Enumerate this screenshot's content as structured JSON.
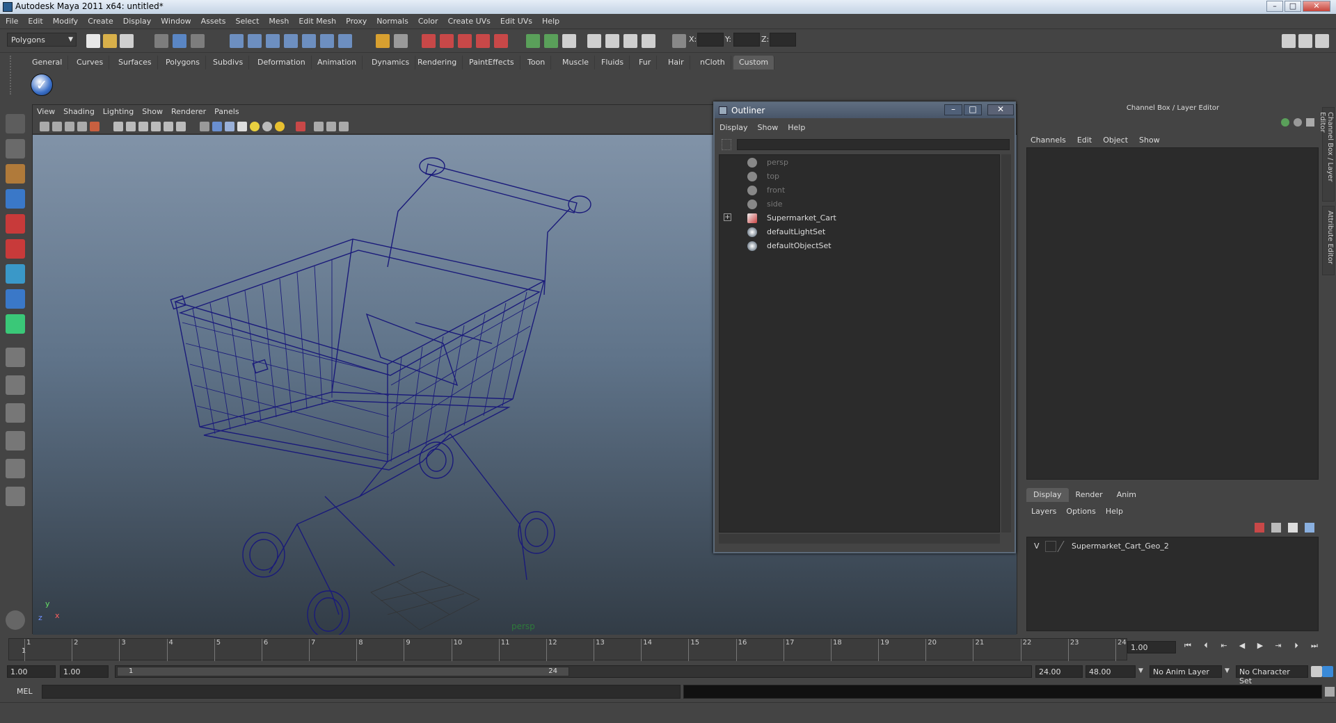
{
  "window": {
    "title": "Autodesk Maya 2011 x64: untitled*"
  },
  "menubar": [
    "File",
    "Edit",
    "Modify",
    "Create",
    "Display",
    "Window",
    "Assets",
    "Select",
    "Mesh",
    "Edit Mesh",
    "Proxy",
    "Normals",
    "Color",
    "Create UVs",
    "Edit UVs",
    "Help"
  ],
  "status": {
    "mode": "Polygons",
    "x_label": "X:",
    "y_label": "Y:",
    "z_label": "Z:"
  },
  "shelf_tabs": [
    "General",
    "Curves",
    "Surfaces",
    "Polygons",
    "Subdivs",
    "Deformation",
    "Animation",
    "Dynamics",
    "Rendering",
    "PaintEffects",
    "Toon",
    "Muscle",
    "Fluids",
    "Fur",
    "Hair",
    "nCloth",
    "Custom"
  ],
  "shelf_active": "Custom",
  "viewport": {
    "menus": [
      "View",
      "Shading",
      "Lighting",
      "Show",
      "Renderer",
      "Panels"
    ],
    "camera_label": "persp",
    "axis": {
      "x": "x",
      "y": "y",
      "z": "z"
    }
  },
  "outliner": {
    "title": "Outliner",
    "menus": [
      "Display",
      "Show",
      "Help"
    ],
    "items": [
      {
        "label": "persp",
        "icon": "camera-icon",
        "dim": true
      },
      {
        "label": "top",
        "icon": "camera-icon",
        "dim": true
      },
      {
        "label": "front",
        "icon": "camera-icon",
        "dim": true
      },
      {
        "label": "side",
        "icon": "camera-icon",
        "dim": true
      },
      {
        "label": "Supermarket_Cart",
        "icon": "mesh-icon",
        "dim": false,
        "expandable": true
      },
      {
        "label": "defaultLightSet",
        "icon": "set-icon",
        "dim": false
      },
      {
        "label": "defaultObjectSet",
        "icon": "set-icon",
        "dim": false
      }
    ],
    "expander_symbol": "+"
  },
  "channelbox": {
    "header": "Channel Box / Layer Editor",
    "menus": [
      "Channels",
      "Edit",
      "Object",
      "Show"
    ],
    "layer_tabs": [
      "Display",
      "Render",
      "Anim"
    ],
    "layer_tab_active": "Display",
    "layer_menus": [
      "Layers",
      "Options",
      "Help"
    ],
    "layers": [
      {
        "visible": "V",
        "name": "Supermarket_Cart_Geo_2"
      }
    ],
    "side_tabs": [
      "Channel Box / Layer Editor",
      "Attribute Editor"
    ]
  },
  "timeline": {
    "ticks": [
      1,
      2,
      3,
      4,
      5,
      6,
      7,
      8,
      9,
      10,
      11,
      12,
      13,
      14,
      15,
      16,
      17,
      18,
      19,
      20,
      21,
      22,
      23,
      24
    ],
    "current_frame": "1",
    "current_frame_field": "1.00"
  },
  "range": {
    "start": "1.00",
    "playback_start": "1.00",
    "slider_start": "1",
    "slider_end": "24",
    "playback_end": "24.00",
    "end": "48.00",
    "anim_layer": "No Anim Layer",
    "character_set": "No Character Set"
  },
  "cmdline": {
    "label": "MEL"
  },
  "colors": {
    "wireframe": "#1a1a7a",
    "viewport_top": "#8193a8",
    "viewport_bottom": "#323c46",
    "ui_bg": "#444444"
  }
}
